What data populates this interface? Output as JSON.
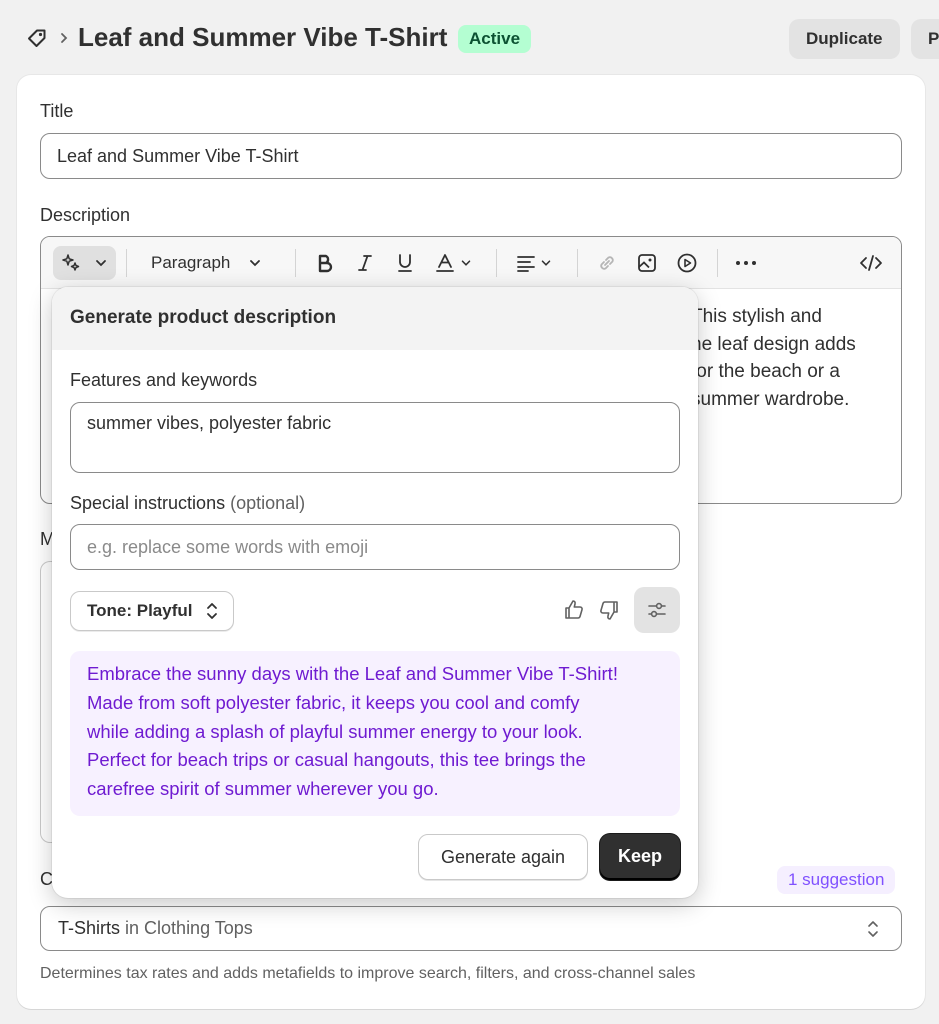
{
  "header": {
    "title": "Leaf and Summer Vibe T-Shirt",
    "status": "Active",
    "duplicate_label": "Duplicate",
    "more_label": "P"
  },
  "form": {
    "title_label": "Title",
    "title_value": "Leaf and Summer Vibe T-Shirt",
    "description_label": "Description",
    "paragraph_label": "Paragraph",
    "description_lines": [
      "This stylish and",
      "he leaf design adds",
      "for the beach or a",
      "summer wardrobe."
    ],
    "media_label": "M",
    "category_label": "C",
    "suggestion_badge": "1 suggestion",
    "category_value": "T-Shirts",
    "category_path": "in Clothing Tops",
    "category_help": "Determines tax rates and adds metafields to improve search, filters, and cross-channel sales"
  },
  "generator": {
    "title": "Generate product description",
    "features_label": "Features and keywords",
    "features_value": "summer vibes, polyester fabric",
    "special_label": "Special instructions",
    "special_optional": "(optional)",
    "special_placeholder": "e.g. replace some words with emoji",
    "tone_label": "Tone: Playful",
    "generated_lines": [
      "Embrace the sunny days with the Leaf and Summer Vibe T-Shirt!",
      "Made from soft polyester fabric, it keeps you cool and comfy",
      "while adding a splash of playful summer energy to your look.",
      "Perfect for beach trips or casual hangouts, this tee brings the",
      "carefree spirit of summer wherever you go."
    ],
    "generate_again_label": "Generate again",
    "keep_label": "Keep"
  },
  "colors": {
    "active_badge_bg": "#b4fed2",
    "generated_text": "#6f1bd1",
    "generated_bg": "#f7f1ff",
    "primary_button": "#303030"
  },
  "icons": [
    "tag-icon",
    "chevron-right-icon",
    "magic-icon",
    "chevron-down-icon",
    "bold-icon",
    "italic-icon",
    "underline-icon",
    "text-color-icon",
    "align-icon",
    "link-icon",
    "image-icon",
    "video-icon",
    "more-icon",
    "code-icon",
    "select-icon",
    "thumbs-up-icon",
    "thumbs-down-icon",
    "settings-sliders-icon"
  ]
}
